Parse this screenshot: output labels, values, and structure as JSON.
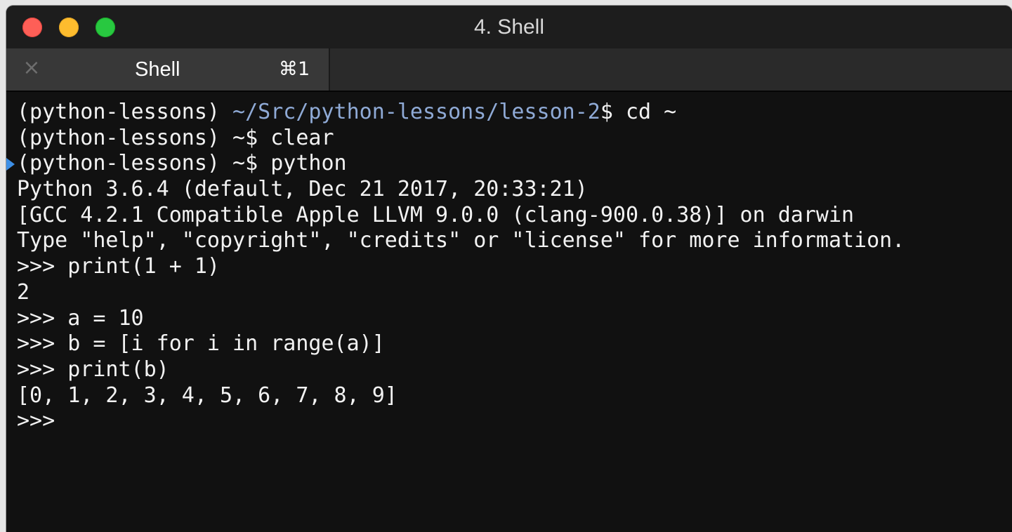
{
  "window": {
    "title": "4. Shell"
  },
  "tabs": [
    {
      "label": "Shell",
      "shortcut": "⌘1",
      "close_glyph": "×",
      "icon": "close-icon"
    }
  ],
  "colors": {
    "background": "#111111",
    "text": "#f2f2f2",
    "path": "#8faad6",
    "mark": "#3d8fe6",
    "traffic_close": "#fe5f57",
    "traffic_minimize": "#febc2e",
    "traffic_zoom": "#28c840"
  },
  "terminal": {
    "lines": [
      {
        "prefix": "(python-lessons) ",
        "path": "~/Src/python-lessons/lesson-2",
        "text": "$ cd ~"
      },
      {
        "prefix": "(python-lessons) ~$ clear"
      },
      {
        "prefix": "(python-lessons) ~$ python",
        "mark": true
      },
      {
        "prefix": "Python 3.6.4 (default, Dec 21 2017, 20:33:21)"
      },
      {
        "prefix": "[GCC 4.2.1 Compatible Apple LLVM 9.0.0 (clang-900.0.38)] on darwin"
      },
      {
        "prefix": "Type \"help\", \"copyright\", \"credits\" or \"license\" for more information."
      },
      {
        "prefix": ">>> print(1 + 1)"
      },
      {
        "prefix": "2"
      },
      {
        "prefix": ">>> a = 10"
      },
      {
        "prefix": ">>> b = [i for i in range(a)]"
      },
      {
        "prefix": ">>> print(b)"
      },
      {
        "prefix": "[0, 1, 2, 3, 4, 5, 6, 7, 8, 9]"
      },
      {
        "prefix": ">>>"
      }
    ]
  }
}
